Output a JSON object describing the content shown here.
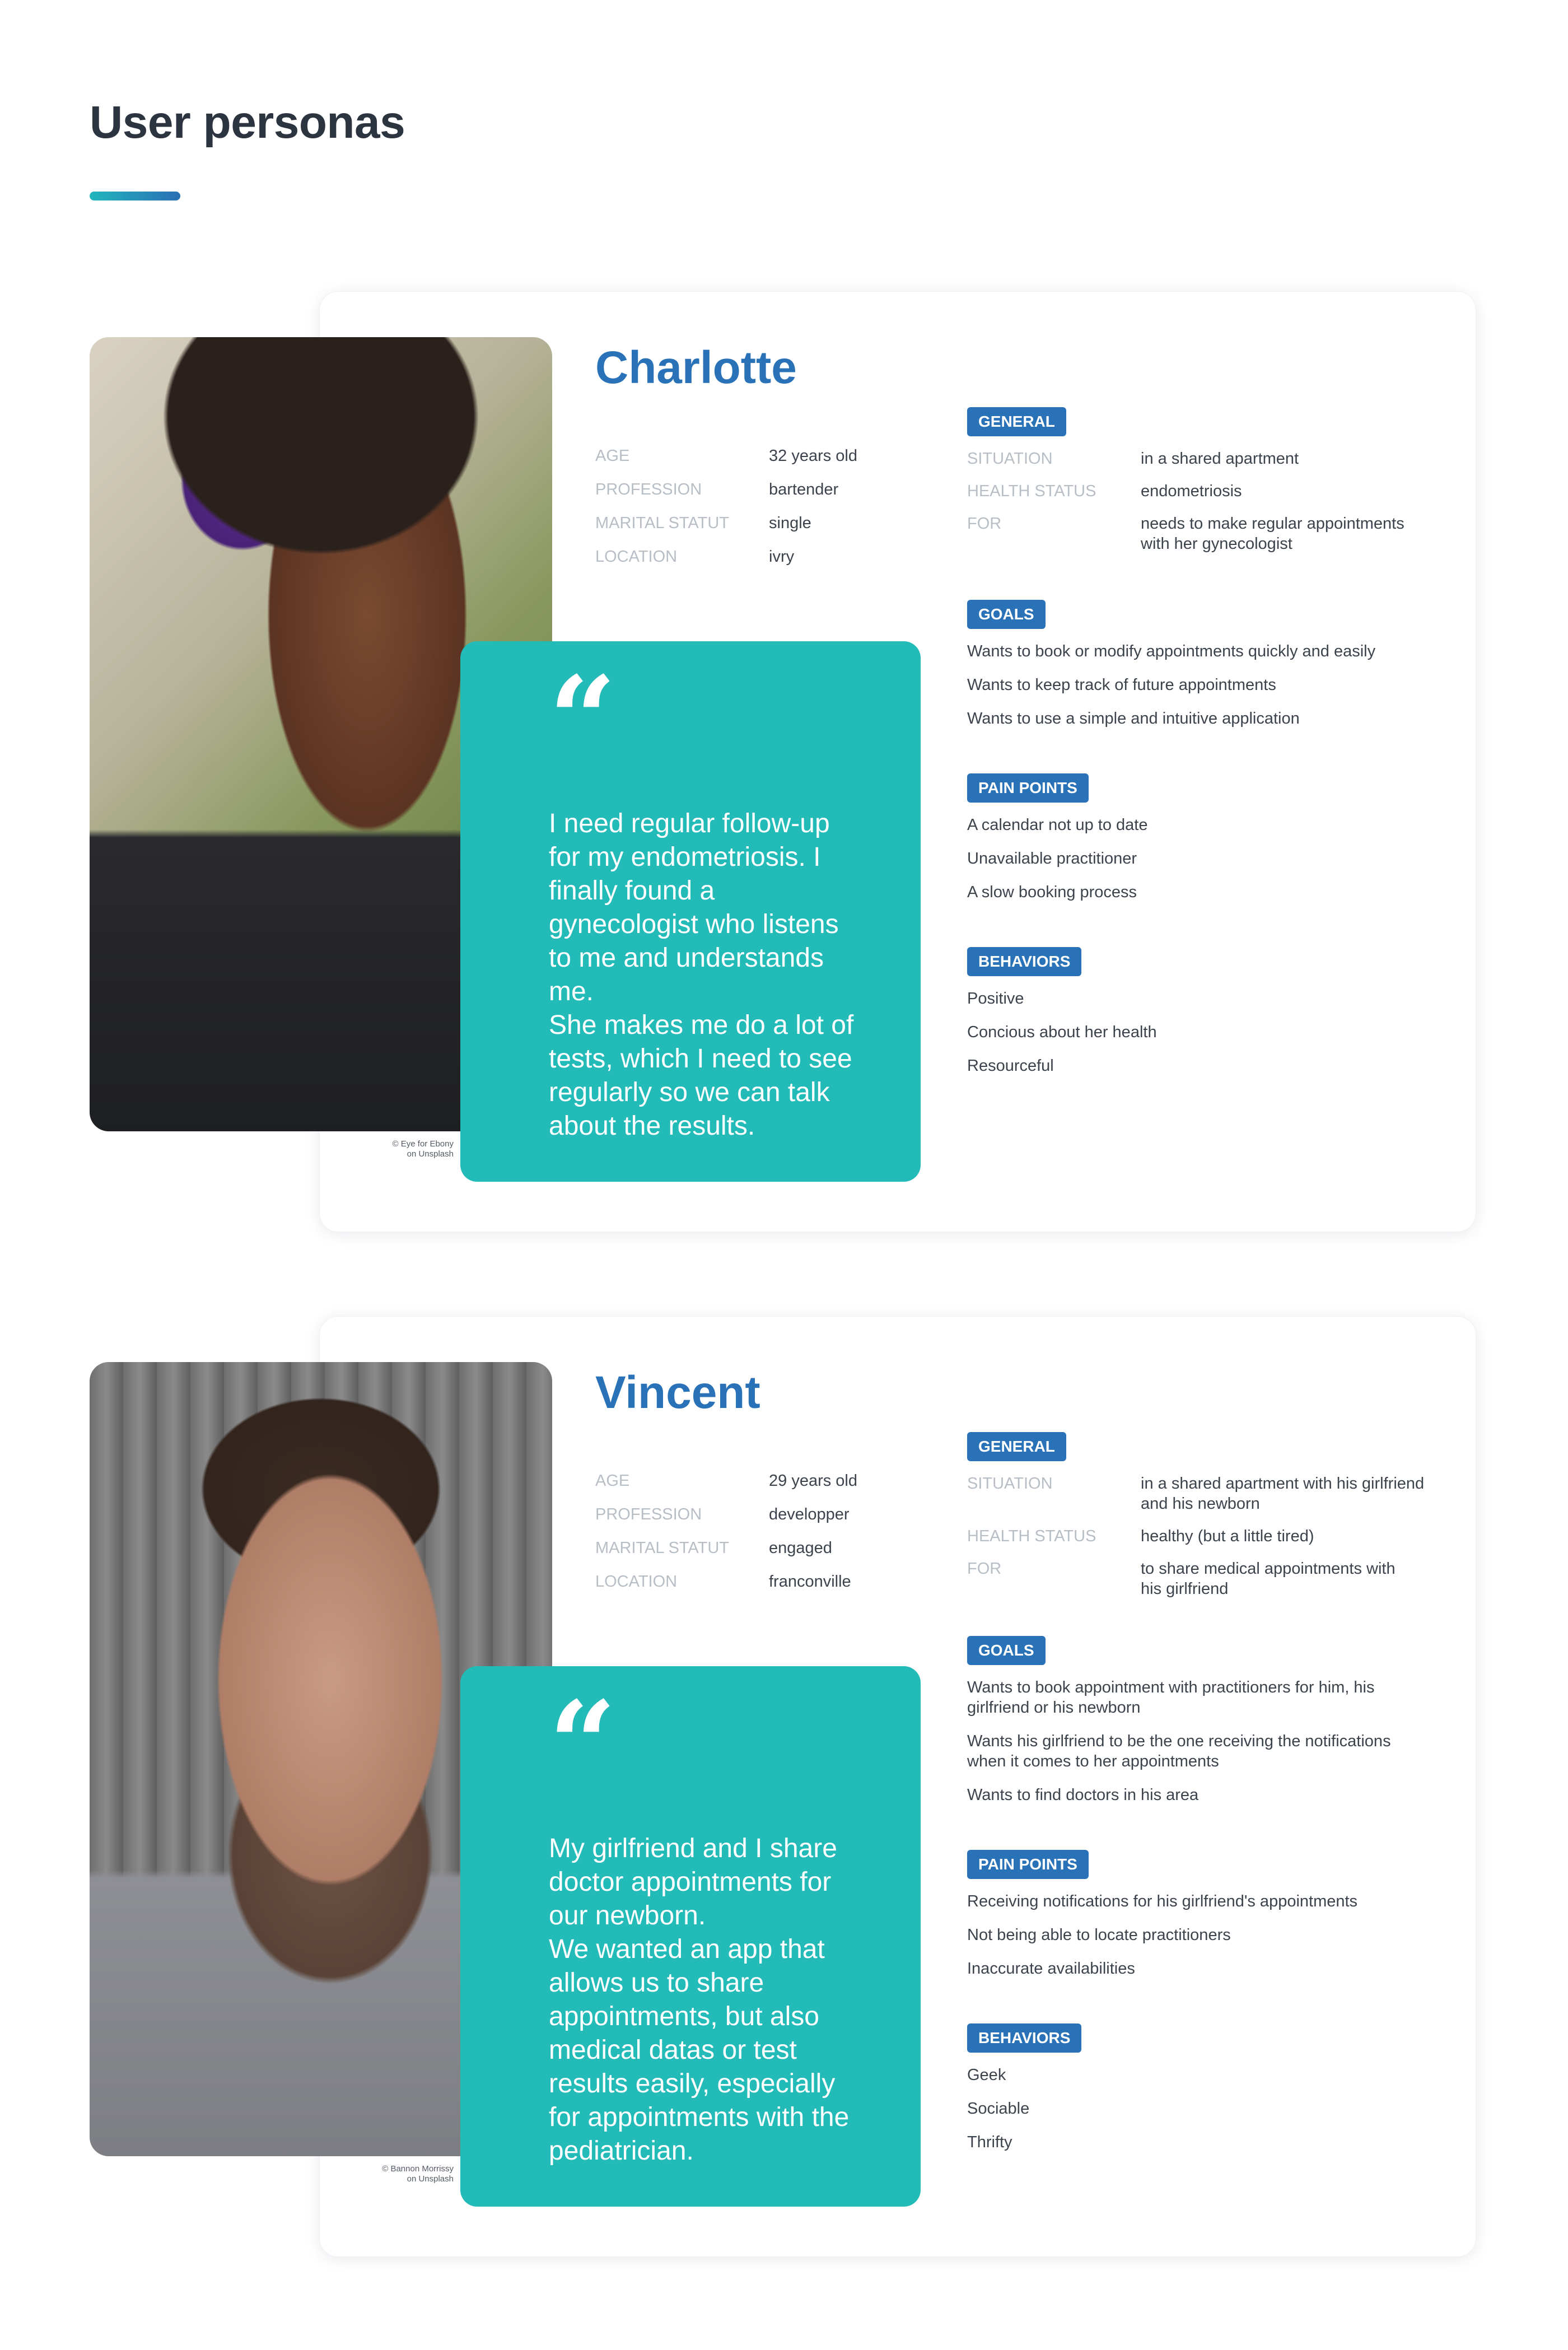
{
  "page": {
    "title": "User personas",
    "accent_gradient": [
      "#21b6bd",
      "#2a6fb5"
    ],
    "colors": {
      "name": "#2a72b8",
      "badge": "#2a72b8",
      "quote_bg": "#22bbb8",
      "label": "#b8bec6"
    }
  },
  "labels": {
    "age": "AGE",
    "profession": "PROFESSION",
    "marital": "MARITAL STATUT",
    "location": "LOCATION",
    "general": "GENERAL",
    "situation": "SITUATION",
    "health_status": "HEALTH STATUS",
    "for": "FOR",
    "goals": "GOALS",
    "pain_points": "PAIN POINTS",
    "behaviors": "BEHAVIORS",
    "quote_icon": "quote-icon"
  },
  "personas": [
    {
      "name": "Charlotte",
      "photo_credit": "© Eye for Ebony\non Unsplash",
      "age": "32 years old",
      "profession": "bartender",
      "marital": "single",
      "location": "ivry",
      "situation": "in a shared apartment",
      "health_status": "endometriosis",
      "for": "needs to make regular appointments\nwith her gynecologist",
      "quote": "I need regular follow-up\nfor my endometriosis. I\nfinally found a\ngynecologist who listens\nto me and understands\nme.\nShe makes me do a lot of\ntests, which I need to see\nregularly so we can talk\nabout the results.",
      "goals": [
        "Wants to book or modify appointments quickly and easily",
        "Wants to keep track of future appointments",
        "Wants to use a simple and intuitive application"
      ],
      "pain_points": [
        "A calendar not up to date",
        "Unavailable practitioner",
        "A slow booking process"
      ],
      "behaviors": [
        "Positive",
        "Concious about her health",
        "Resourceful"
      ]
    },
    {
      "name": "Vincent",
      "photo_credit": "© Bannon Morrissy\non Unsplash",
      "age": "29 years old",
      "profession": "developper",
      "marital": "engaged",
      "location": "franconville",
      "situation": "in a shared apartment with his girlfriend\nand his newborn",
      "health_status": "healthy (but a little tired)",
      "for": "to share medical appointments with\nhis girlfriend",
      "quote": "My girlfriend and I share\ndoctor appointments for\nour newborn.\nWe wanted an app that\nallows us to share\nappointments, but also\nmedical datas or test\nresults easily, especially\nfor appointments with the\npediatrician.",
      "goals": [
        "Wants to book appointment with practitioners for him, his\ngirlfriend or his newborn",
        "Wants his girlfriend to be the one receiving the notifications\nwhen it comes to her appointments",
        "Wants to find doctors in his area"
      ],
      "pain_points": [
        "Receiving notifications for his girlfriend's appointments",
        "Not being able to locate practitioners",
        "Inaccurate availabilities"
      ],
      "behaviors": [
        "Geek",
        "Sociable",
        "Thrifty"
      ]
    }
  ]
}
